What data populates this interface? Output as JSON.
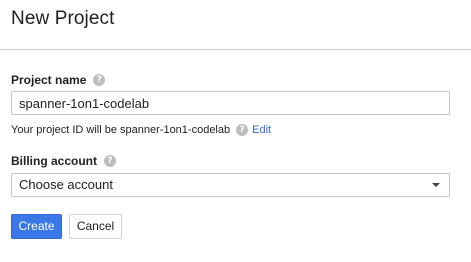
{
  "dialog": {
    "title": "New Project"
  },
  "project_name": {
    "label": "Project name",
    "help_icon": "?",
    "value": "spanner-1on1-codelab",
    "id_note": "Your project ID will be spanner-1on1-codelab",
    "id_help_icon": "?",
    "edit_label": "Edit"
  },
  "billing": {
    "label": "Billing account",
    "help_icon": "?",
    "selected": "Choose account"
  },
  "actions": {
    "create_label": "Create",
    "cancel_label": "Cancel"
  },
  "colors": {
    "primary_button": "#3b78e7",
    "link": "#3367d6"
  }
}
